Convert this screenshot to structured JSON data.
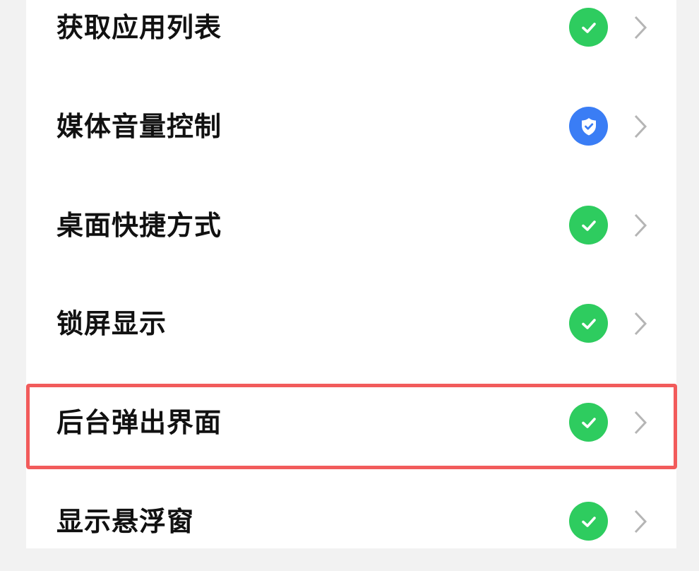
{
  "permissions": [
    {
      "label": "获取应用列表",
      "status": "allowed",
      "status_icon": "check-icon",
      "status_color": "#2ecc5f"
    },
    {
      "label": "媒体音量控制",
      "status": "protected",
      "status_icon": "shield-check-icon",
      "status_color": "#3a7df5"
    },
    {
      "label": "桌面快捷方式",
      "status": "allowed",
      "status_icon": "check-icon",
      "status_color": "#2ecc5f"
    },
    {
      "label": "锁屏显示",
      "status": "allowed",
      "status_icon": "check-icon",
      "status_color": "#2ecc5f"
    },
    {
      "label": "后台弹出界面",
      "status": "allowed",
      "status_icon": "check-icon",
      "status_color": "#2ecc5f"
    },
    {
      "label": "显示悬浮窗",
      "status": "allowed",
      "status_icon": "check-icon",
      "status_color": "#2ecc5f"
    }
  ],
  "highlighted_item": "后台弹出界面",
  "colors": {
    "highlight_border": "#f25b5b",
    "chevron": "#b5b5b5",
    "page_background": "#f2f2f2"
  }
}
